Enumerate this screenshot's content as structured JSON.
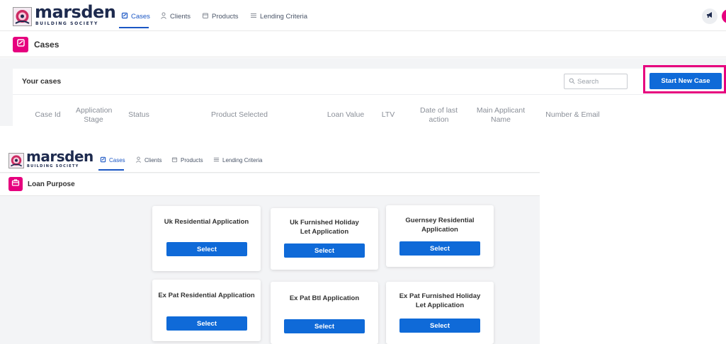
{
  "top": {
    "logo": {
      "word": "marsden",
      "sub": "BUILDING SOCIETY"
    },
    "nav": [
      {
        "label": "Cases",
        "icon": "clipboard-icon",
        "active": true
      },
      {
        "label": "Clients",
        "icon": "person-icon",
        "active": false
      },
      {
        "label": "Products",
        "icon": "box-icon",
        "active": false
      },
      {
        "label": "Lending Criteria",
        "icon": "list-icon",
        "active": false
      }
    ],
    "page_title": "Cases",
    "section_title": "Your cases",
    "search": {
      "placeholder": "Search"
    },
    "start_button": "Start New Case",
    "columns": [
      "Case Id",
      "Application Stage",
      "Status",
      "Product Selected",
      "Loan Value",
      "LTV",
      "Date of last action",
      "Main Applicant Name",
      "Number & Email"
    ]
  },
  "bottom": {
    "logo": {
      "word": "marsden",
      "sub": "BUILDING SOCIETY"
    },
    "nav": [
      {
        "label": "Cases",
        "icon": "clipboard-icon",
        "active": true
      },
      {
        "label": "Clients",
        "icon": "person-icon",
        "active": false
      },
      {
        "label": "Products",
        "icon": "box-icon",
        "active": false
      },
      {
        "label": "Lending Criteria",
        "icon": "list-icon",
        "active": false
      }
    ],
    "page_title": "Loan Purpose",
    "cards": [
      {
        "title": "Uk Residential Application",
        "button": "Select"
      },
      {
        "title": "Uk Furnished Holiday Let Application",
        "button": "Select"
      },
      {
        "title": "Guernsey Residential Application",
        "button": "Select"
      },
      {
        "title": "Ex Pat Residential Application",
        "button": "Select"
      },
      {
        "title": "Ex Pat Btl Application",
        "button": "Select"
      },
      {
        "title": "Ex Pat Furnished Holiday Let Application",
        "button": "Select"
      }
    ]
  },
  "colors": {
    "accent": "#1a56c4",
    "brand_pink": "#e6007e",
    "button_blue": "#0f6ad8",
    "navy": "#1d2a4e"
  }
}
